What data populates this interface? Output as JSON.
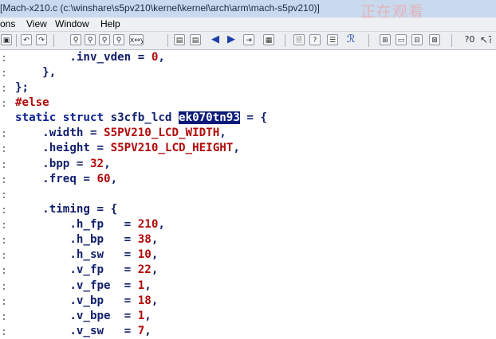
{
  "window": {
    "title": "[Mach-x210.c (c:\\winshare\\s5pv210\\kernel\\kernel\\arch\\arm\\mach-s5pv210)]",
    "watermark": "正在观看"
  },
  "menu": {
    "items": [
      "ons",
      "View",
      "Window",
      "Help"
    ]
  },
  "toolbar": {
    "icons": [
      "open-icon",
      "undo-icon",
      "redo-icon",
      "binoculars-icon",
      "find-next-icon",
      "find-prev-icon",
      "find-all-icon",
      "replace-icon",
      "bookmark-icon",
      "bookmark-next-icon",
      "arrow-left-icon",
      "arrow-right-icon",
      "jump-icon",
      "symbol-icon",
      "file-icon",
      "book-icon",
      "paint-icon",
      "window-tile-icon",
      "window-icon",
      "window-split-icon",
      "window-close-icon",
      "help-icon",
      "pointer-icon"
    ]
  },
  "editor": {
    "lines": [
      {
        "colon": ":",
        "segs": [
          {
            "t": "        .inv_vden = ",
            "c": "txt"
          },
          {
            "t": "0",
            "c": "num"
          },
          {
            "t": ",",
            "c": "txt"
          }
        ]
      },
      {
        "colon": ":",
        "segs": [
          {
            "t": "    },",
            "c": "txt"
          }
        ]
      },
      {
        "colon": ":",
        "segs": [
          {
            "t": "};",
            "c": "txt"
          }
        ]
      },
      {
        "colon": ":",
        "segs": [
          {
            "t": "#else",
            "c": "pp"
          }
        ]
      },
      {
        "colon": "",
        "segs": [
          {
            "t": "static struct ",
            "c": "kw"
          },
          {
            "t": "s3cfb_lcd ",
            "c": "txt"
          },
          {
            "t": "ek070tn93",
            "c": "sel"
          },
          {
            "t": " = {",
            "c": "txt"
          }
        ]
      },
      {
        "colon": ":",
        "segs": [
          {
            "t": "    .width = ",
            "c": "txt"
          },
          {
            "t": "S5PV210_LCD_WIDTH",
            "c": "red"
          },
          {
            "t": ",",
            "c": "txt"
          }
        ]
      },
      {
        "colon": ":",
        "segs": [
          {
            "t": "    .height = ",
            "c": "txt"
          },
          {
            "t": "S5PV210_LCD_HEIGHT",
            "c": "red"
          },
          {
            "t": ",",
            "c": "txt"
          }
        ]
      },
      {
        "colon": ":",
        "segs": [
          {
            "t": "    .bpp = ",
            "c": "txt"
          },
          {
            "t": "32",
            "c": "num"
          },
          {
            "t": ",",
            "c": "txt"
          }
        ]
      },
      {
        "colon": ":",
        "segs": [
          {
            "t": "    .freq = ",
            "c": "txt"
          },
          {
            "t": "60",
            "c": "num"
          },
          {
            "t": ",",
            "c": "txt"
          }
        ]
      },
      {
        "colon": ":",
        "segs": []
      },
      {
        "colon": ":",
        "segs": [
          {
            "t": "    .timing = {",
            "c": "txt"
          }
        ]
      },
      {
        "colon": ":",
        "segs": [
          {
            "t": "        .h_fp   = ",
            "c": "txt"
          },
          {
            "t": "210",
            "c": "num"
          },
          {
            "t": ",",
            "c": "txt"
          }
        ]
      },
      {
        "colon": ":",
        "segs": [
          {
            "t": "        .h_bp   = ",
            "c": "txt"
          },
          {
            "t": "38",
            "c": "num"
          },
          {
            "t": ",",
            "c": "txt"
          }
        ]
      },
      {
        "colon": ":",
        "segs": [
          {
            "t": "        .h_sw   = ",
            "c": "txt"
          },
          {
            "t": "10",
            "c": "num"
          },
          {
            "t": ",",
            "c": "txt"
          }
        ]
      },
      {
        "colon": ":",
        "segs": [
          {
            "t": "        .v_fp   = ",
            "c": "txt"
          },
          {
            "t": "22",
            "c": "num"
          },
          {
            "t": ",",
            "c": "txt"
          }
        ]
      },
      {
        "colon": ":",
        "segs": [
          {
            "t": "        .v_fpe  = ",
            "c": "txt"
          },
          {
            "t": "1",
            "c": "num"
          },
          {
            "t": ",",
            "c": "txt"
          }
        ]
      },
      {
        "colon": ":",
        "segs": [
          {
            "t": "        .v_bp   = ",
            "c": "txt"
          },
          {
            "t": "18",
            "c": "num"
          },
          {
            "t": ",",
            "c": "txt"
          }
        ]
      },
      {
        "colon": ":",
        "segs": [
          {
            "t": "        .v_bpe  = ",
            "c": "txt"
          },
          {
            "t": "1",
            "c": "num"
          },
          {
            "t": ",",
            "c": "txt"
          }
        ]
      },
      {
        "colon": ":",
        "segs": [
          {
            "t": "        .v_sw   = ",
            "c": "txt"
          },
          {
            "t": "7",
            "c": "num"
          },
          {
            "t": ",",
            "c": "txt"
          }
        ]
      }
    ]
  },
  "colors": {
    "keyword": "#0a1e8f",
    "text": "#111f6b",
    "number": "#b00a0a",
    "selection_bg": "#0b1a7a"
  }
}
